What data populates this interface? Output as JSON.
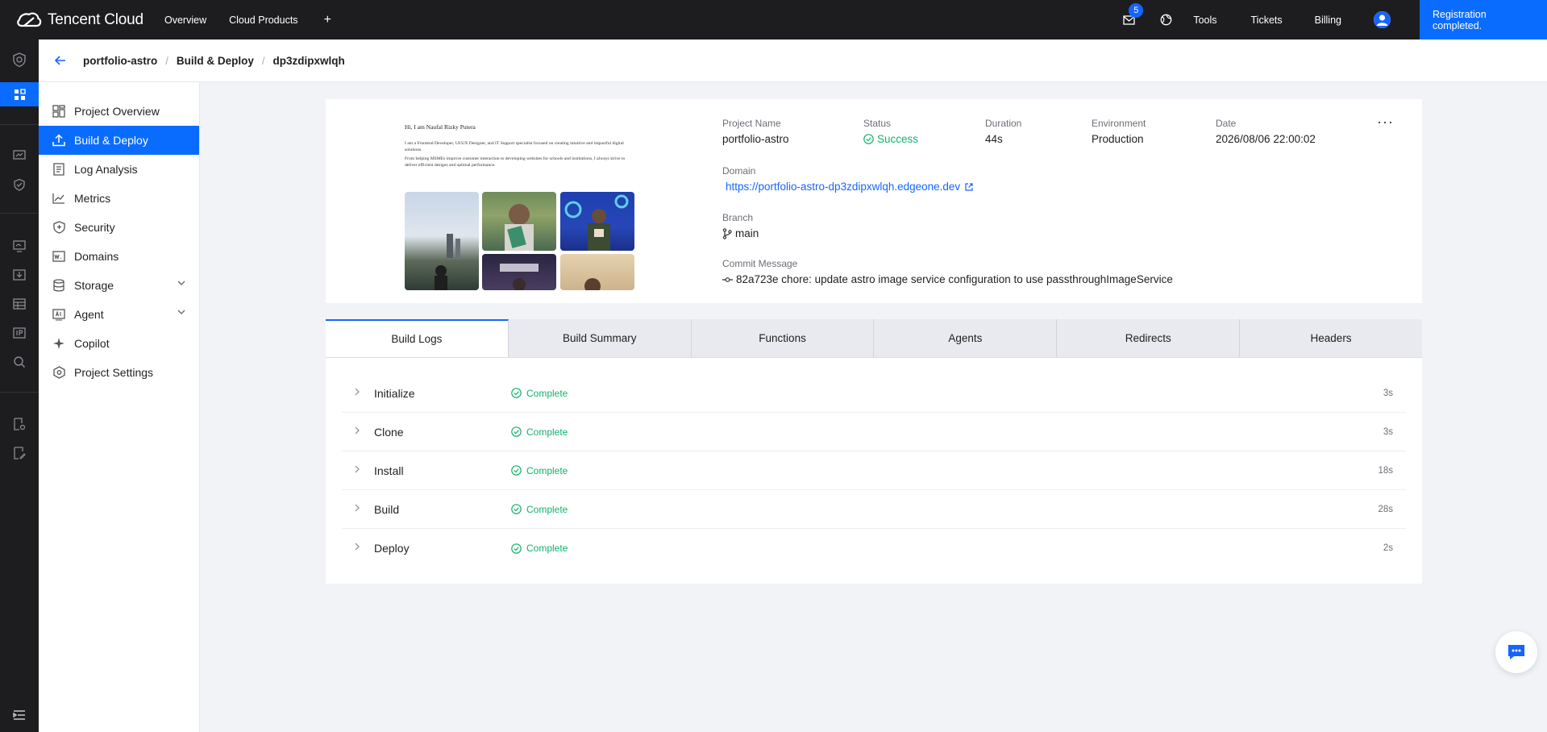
{
  "topbar": {
    "brand": "Tencent Cloud",
    "nav": [
      "Overview",
      "Cloud Products"
    ],
    "plus": "+",
    "mail_badge": "5",
    "links": [
      "Tools",
      "Tickets",
      "Billing"
    ],
    "registration": "Registration completed."
  },
  "breadcrumb": {
    "items": [
      "portfolio-astro",
      "Build & Deploy",
      "dp3zdipxwlqh"
    ],
    "separator": "/"
  },
  "sidemenu": {
    "items": [
      {
        "label": "Project Overview",
        "icon": "grid-icon"
      },
      {
        "label": "Build & Deploy",
        "icon": "upload-icon",
        "active": true
      },
      {
        "label": "Log Analysis",
        "icon": "document-icon"
      },
      {
        "label": "Metrics",
        "icon": "chart-icon"
      },
      {
        "label": "Security",
        "icon": "shield-icon"
      },
      {
        "label": "Domains",
        "icon": "domain-icon"
      },
      {
        "label": "Storage",
        "icon": "database-icon",
        "expandable": true
      },
      {
        "label": "Agent",
        "icon": "agent-icon",
        "expandable": true
      },
      {
        "label": "Copilot",
        "icon": "sparkle-icon"
      },
      {
        "label": "Project Settings",
        "icon": "settings-icon"
      }
    ]
  },
  "preview": {
    "greeting": "Hi, I am Naufal Rizky Putera",
    "para1": "I am a Frontend Developer, UI/UX Designer, and IT Support specialist focused on creating intuitive and impactful digital solutions.",
    "para2": "From helping MSMEs improve customer interaction to developing websites for schools and institutions, I always strive to deliver efficient designs and optimal performance."
  },
  "deployment": {
    "project_name_label": "Project Name",
    "project_name": "portfolio-astro",
    "status_label": "Status",
    "status": "Success",
    "duration_label": "Duration",
    "duration": "44s",
    "environment_label": "Environment",
    "environment": "Production",
    "date_label": "Date",
    "date": "2026/08/06 22:00:02",
    "domain_label": "Domain",
    "domain": "https://portfolio-astro-dp3zdipxwlqh.edgeone.dev",
    "branch_label": "Branch",
    "branch": "main",
    "commit_label": "Commit Message",
    "commit": "82a723e chore: update astro image service configuration to use passthroughImageService",
    "more": "···"
  },
  "tabs": [
    "Build Logs",
    "Build Summary",
    "Functions",
    "Agents",
    "Redirects",
    "Headers"
  ],
  "active_tab": "Build Logs",
  "logs": [
    {
      "name": "Initialize",
      "status": "Complete",
      "duration": "3s"
    },
    {
      "name": "Clone",
      "status": "Complete",
      "duration": "3s"
    },
    {
      "name": "Install",
      "status": "Complete",
      "duration": "18s"
    },
    {
      "name": "Build",
      "status": "Complete",
      "duration": "28s"
    },
    {
      "name": "Deploy",
      "status": "Complete",
      "duration": "2s"
    }
  ],
  "colors": {
    "accent": "#0a6cff",
    "link": "#1664ff",
    "success": "#10b36b",
    "topbar": "#1d1d1f"
  }
}
